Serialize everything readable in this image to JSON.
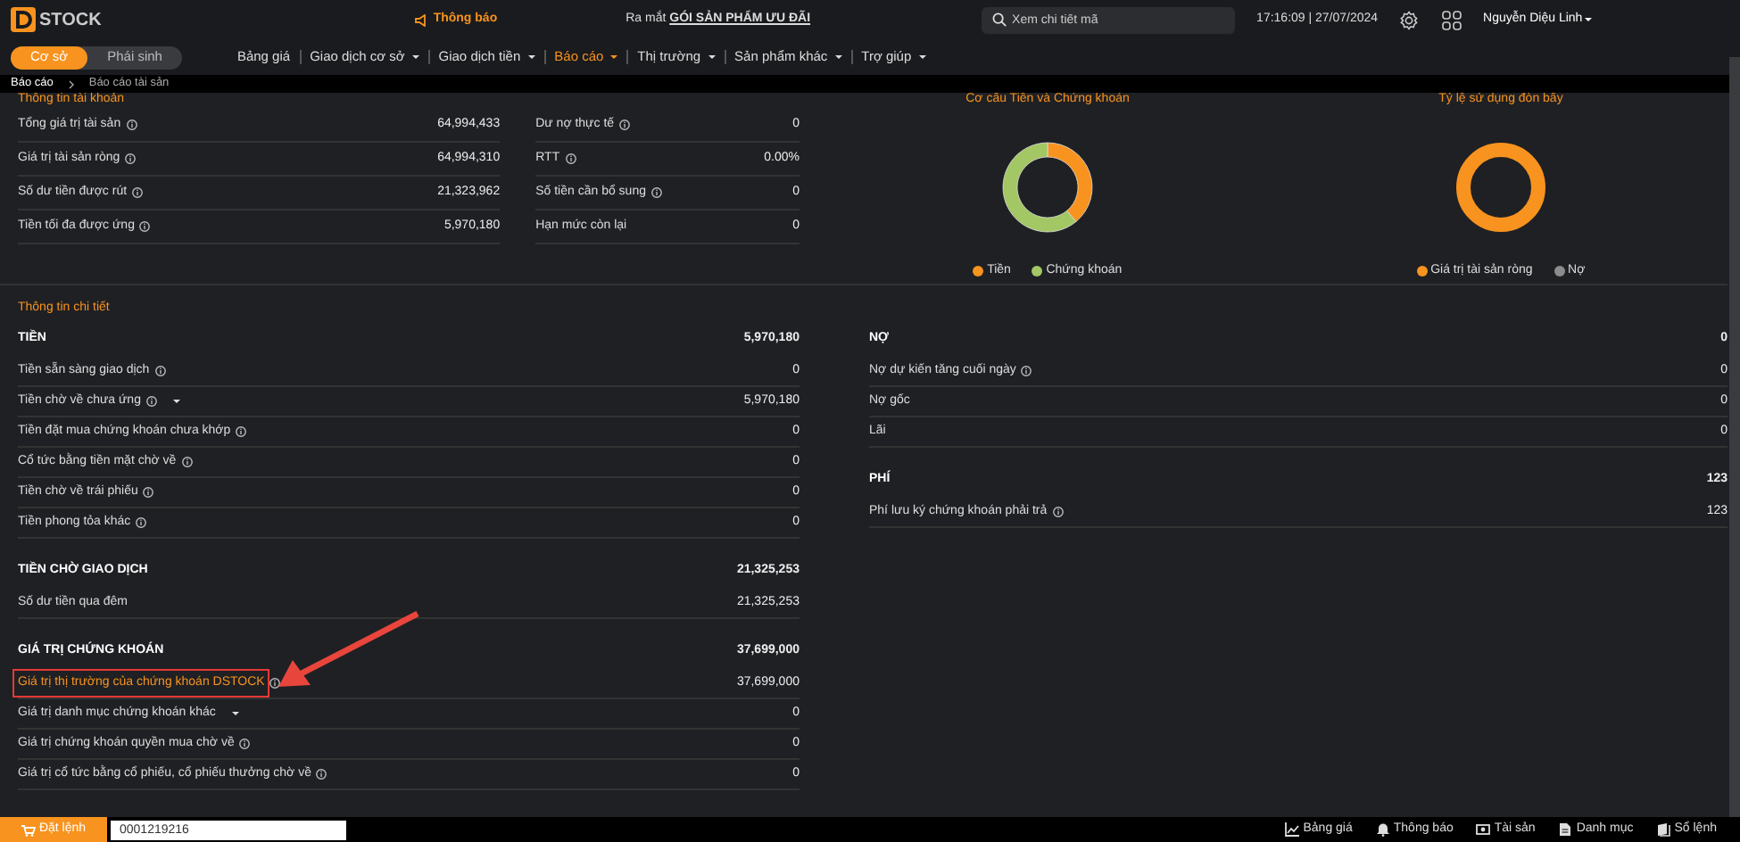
{
  "header": {
    "logo": "STOCK",
    "notice": "Thông báo",
    "promo": {
      "prefix": "Ra mắt",
      "link": "GÓI SẢN PHẨM ƯU ĐÃI"
    },
    "search": {
      "placeholder": "Xem chi tiết mã"
    },
    "datetime": "17:16:09 | 27/07/2024",
    "user": "Nguyễn Diệu Linh"
  },
  "market_toggle": [
    {
      "label": "Cơ sở",
      "selected": true
    },
    {
      "label": "Phái sinh",
      "selected": false
    }
  ],
  "menu": [
    {
      "label": "Bảng giá",
      "selected": false,
      "dropdown": false
    },
    {
      "label": "Giao dịch cơ sở",
      "selected": false,
      "dropdown": true
    },
    {
      "label": "Giao dịch tiền",
      "selected": false,
      "dropdown": true
    },
    {
      "label": "Báo cáo",
      "selected": true,
      "dropdown": true
    },
    {
      "label": "Thị trường",
      "selected": false,
      "dropdown": true
    },
    {
      "label": "Sản phẩm khác",
      "selected": false,
      "dropdown": true
    },
    {
      "label": "Trợ giúp",
      "selected": false,
      "dropdown": true
    }
  ],
  "breadcrumb": [
    "Báo cáo",
    "Báo cáo tài sản"
  ],
  "account_info": {
    "title": "Thông tin tài khoản",
    "left": [
      {
        "label": "Tổng giá trị tài sản",
        "value": "64,994,433",
        "info": true
      },
      {
        "label": "Giá trị tài sản ròng",
        "value": "64,994,310",
        "info": true
      },
      {
        "label": "Số dư tiền được rút",
        "value": "21,323,962",
        "info": true
      },
      {
        "label": "Tiền tối đa được ứng",
        "value": "5,970,180",
        "info": true
      }
    ],
    "right": [
      {
        "label": "Dư nợ thực tế",
        "value": "0",
        "info": true
      },
      {
        "label": "RTT",
        "value": "0.00%",
        "info": true
      },
      {
        "label": "Số tiền cần bổ sung",
        "value": "0",
        "info": true
      },
      {
        "label": "Hạn mức còn lại",
        "value": "0",
        "info": false
      }
    ]
  },
  "charts": [
    {
      "title": "Cơ cấu Tiền và Chứng khoán",
      "legend": [
        {
          "label": "Tiền",
          "color": "#f7931e"
        },
        {
          "label": "Chứng khoán",
          "color": "#a3c764"
        }
      ]
    },
    {
      "title": "Tỷ lệ sử dụng đòn bẩy",
      "legend": [
        {
          "label": "Giá trị tài sản ròng",
          "color": "#f7931e"
        },
        {
          "label": "Nợ",
          "color": "#8c8c8c"
        }
      ]
    }
  ],
  "details": {
    "title": "Thông tin chi tiết",
    "left": [
      {
        "heading": "TIỀN",
        "total": "5,970,180",
        "rows": [
          {
            "label": "Tiền sẵn sàng giao dịch",
            "value": "0",
            "info": true,
            "dropdown": false,
            "highlighted": false
          },
          {
            "label": "Tiền chờ về chưa ứng",
            "value": "5,970,180",
            "info": true,
            "dropdown": true,
            "highlighted": false
          },
          {
            "label": "Tiền đặt mua chứng khoán chưa khớp",
            "value": "0",
            "info": true,
            "dropdown": false,
            "highlighted": false
          },
          {
            "label": "Cổ tức bằng tiền mặt chờ về",
            "value": "0",
            "info": true,
            "dropdown": false,
            "highlighted": false
          },
          {
            "label": "Tiền chờ về trái phiếu",
            "value": "0",
            "info": true,
            "dropdown": false,
            "highlighted": false
          },
          {
            "label": "Tiền phong tỏa khác",
            "value": "0",
            "info": true,
            "dropdown": false,
            "highlighted": false
          }
        ]
      },
      {
        "heading": "TIỀN CHỜ GIAO DỊCH",
        "total": "21,325,253",
        "rows": [
          {
            "label": "Số dư tiền qua đêm",
            "value": "21,325,253",
            "info": false,
            "dropdown": false,
            "highlighted": false
          }
        ]
      },
      {
        "heading": "GIÁ TRỊ CHỨNG KHOÁN",
        "total": "37,699,000",
        "rows": [
          {
            "label": "Giá trị thị trường của chứng khoán DSTOCK",
            "value": "37,699,000",
            "info": true,
            "dropdown": false,
            "highlighted": true
          },
          {
            "label": "Giá trị danh mục chứng khoán khác",
            "value": "0",
            "info": false,
            "dropdown": true,
            "highlighted": false
          },
          {
            "label": "Giá trị chứng khoán quyền mua chờ về",
            "value": "0",
            "info": true,
            "dropdown": false,
            "highlighted": false
          },
          {
            "label": "Giá trị cổ tức bằng cổ phiếu, cổ phiếu thưởng chờ về",
            "value": "0",
            "info": true,
            "dropdown": false,
            "highlighted": false
          }
        ]
      }
    ],
    "right": [
      {
        "heading": "NỢ",
        "total": "0",
        "rows": [
          {
            "label": "Nợ dự kiến tăng cuối ngày",
            "value": "0",
            "info": true,
            "dropdown": false,
            "highlighted": false
          },
          {
            "label": "Nợ gốc",
            "value": "0",
            "info": false,
            "dropdown": false,
            "highlighted": false
          },
          {
            "label": "Lãi",
            "value": "0",
            "info": false,
            "dropdown": false,
            "highlighted": false
          }
        ]
      },
      {
        "heading": "PHÍ",
        "total": "123",
        "rows": [
          {
            "label": "Phí lưu ký chứng khoán phải trả",
            "value": "123",
            "info": true,
            "dropdown": false,
            "highlighted": false
          }
        ]
      }
    ]
  },
  "bottom_bar": {
    "order_button": "Đặt lệnh",
    "account": "0001219216",
    "nav": [
      {
        "kind": "chart",
        "label": "Bảng giá"
      },
      {
        "kind": "bell",
        "label": "Thông báo"
      },
      {
        "kind": "card",
        "label": "Tài sản"
      },
      {
        "kind": "doc",
        "label": "Danh mục"
      },
      {
        "kind": "book",
        "label": "Sổ lệnh"
      }
    ]
  }
}
